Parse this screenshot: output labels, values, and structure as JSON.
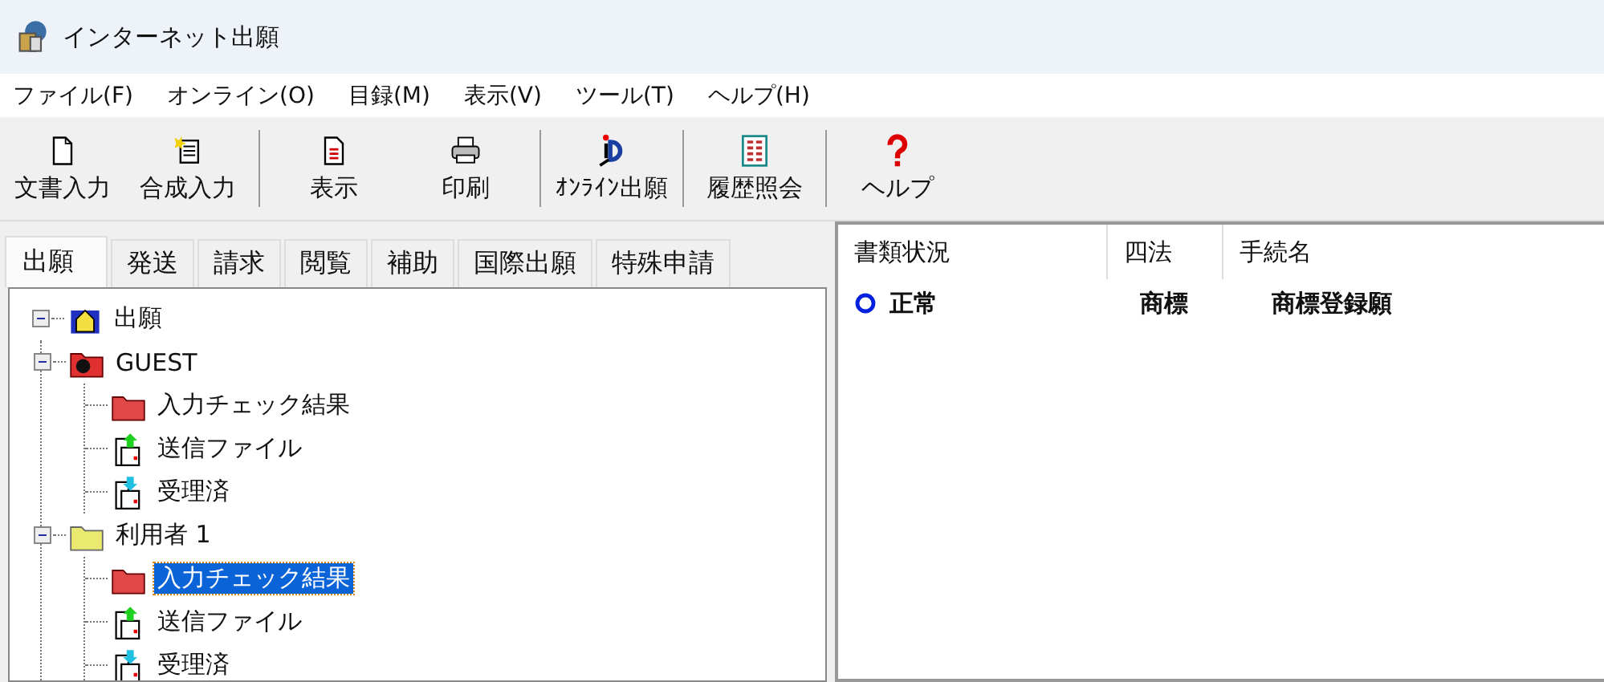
{
  "window": {
    "title": "インターネット出願"
  },
  "menu": [
    "ファイル(F)",
    "オンライン(O)",
    "目録(M)",
    "表示(V)",
    "ツール(T)",
    "ヘルプ(H)"
  ],
  "toolbar": [
    [
      {
        "label": "文書入力",
        "kind": "page"
      },
      {
        "label": "合成入力",
        "kind": "wizard"
      }
    ],
    [
      {
        "label": "表示",
        "kind": "view"
      },
      {
        "label": "印刷",
        "kind": "printer"
      }
    ],
    [
      {
        "label": "ｵﾝﾗｲﾝ出願",
        "kind": "online"
      }
    ],
    [
      {
        "label": "履歴照会",
        "kind": "ledger"
      }
    ],
    [
      {
        "label": "ヘルプ",
        "kind": "help"
      }
    ]
  ],
  "tabs": [
    {
      "label": "出願",
      "selected": true
    },
    {
      "label": "発送",
      "selected": false
    },
    {
      "label": "請求",
      "selected": false
    },
    {
      "label": "閲覧",
      "selected": false
    },
    {
      "label": "補助",
      "selected": false
    },
    {
      "label": "国際出願",
      "selected": false
    },
    {
      "label": "特殊申請",
      "selected": false
    }
  ],
  "tree": {
    "label": "出願",
    "kind": "root",
    "expanded": true,
    "selected": false,
    "children": [
      {
        "label": "GUEST",
        "kind": "guest",
        "expanded": true,
        "selected": false,
        "children": [
          {
            "label": "入力チェック結果",
            "kind": "check",
            "selected": false
          },
          {
            "label": "送信ファイル",
            "kind": "outbox",
            "selected": false
          },
          {
            "label": "受理済",
            "kind": "inbox",
            "selected": false
          }
        ]
      },
      {
        "label": "利用者 1",
        "kind": "user",
        "expanded": true,
        "selected": false,
        "children": [
          {
            "label": "入力チェック結果",
            "kind": "check",
            "selected": true
          },
          {
            "label": "送信ファイル",
            "kind": "outbox",
            "selected": false
          },
          {
            "label": "受理済",
            "kind": "inbox",
            "selected": false
          }
        ]
      }
    ]
  },
  "table": {
    "columns": [
      "書類状況",
      "四法",
      "手続名"
    ],
    "rows": [
      {
        "status": "正常",
        "kind": "ok",
        "law": "商標",
        "procedure": "商標登録願"
      }
    ]
  }
}
